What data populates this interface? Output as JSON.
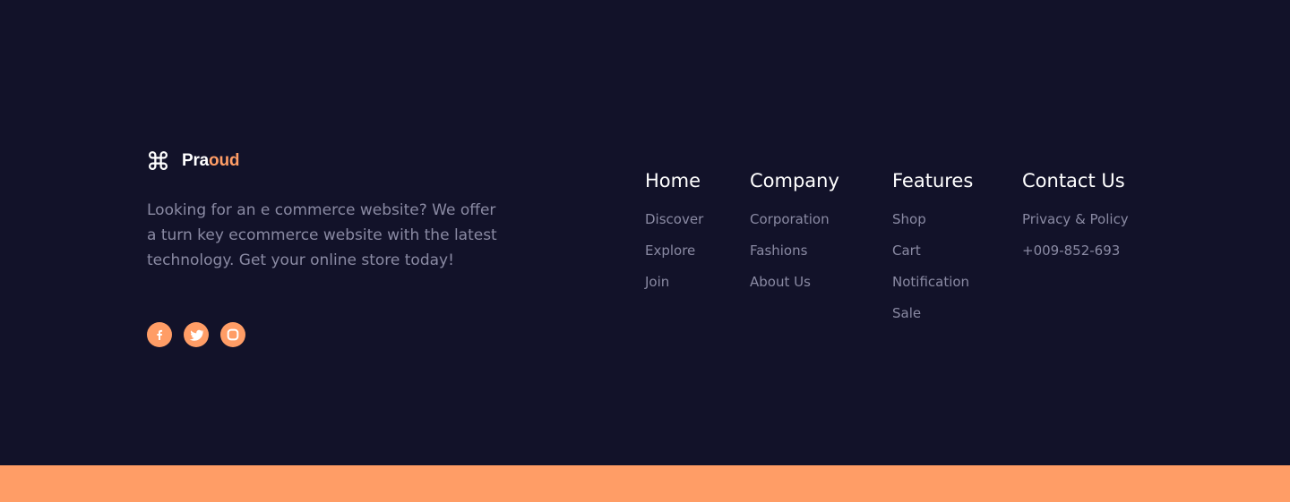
{
  "brand": {
    "name_part1": "Pra",
    "name_part2": "oud",
    "icon": "command-icon",
    "accent_color": "#FF9D66"
  },
  "tagline": "Looking for an e commerce website? We offer a turn key ecommerce website with the latest technology. Get your online store today!",
  "socials": [
    {
      "icon": "facebook-icon",
      "label": "Facebook"
    },
    {
      "icon": "twitter-icon",
      "label": "Twitter"
    },
    {
      "icon": "instagram-icon",
      "label": "Instagram"
    }
  ],
  "columns": {
    "home": {
      "title": "Home",
      "links": [
        "Discover",
        "Explore",
        "Join"
      ]
    },
    "company": {
      "title": "Company",
      "links": [
        "Corporation",
        "Fashions",
        "About Us"
      ]
    },
    "features": {
      "title": "Features",
      "links": [
        "Shop",
        "Cart",
        "Notification",
        "Sale"
      ]
    },
    "contact": {
      "title": "Contact Us",
      "links": [
        "Privacy & Policy",
        "+009-852-693"
      ]
    }
  },
  "colors": {
    "background": "#121229",
    "accent": "#FF9D66",
    "heading": "#FFFFFF",
    "muted_text": "#8A8AA3"
  }
}
